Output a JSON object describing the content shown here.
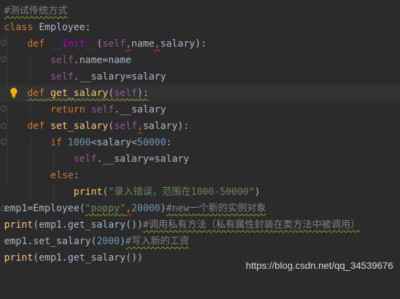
{
  "colors": {
    "background": "#2b2b2b",
    "keyword": "#cc7832",
    "function": "#ffc66d",
    "magic": "#b200b2",
    "self": "#94558d",
    "number": "#6897bb",
    "string": "#6a8759",
    "comment": "#808080",
    "text": "#a9b7c6"
  },
  "icons": {
    "fold": "fold-marker-icon",
    "hint": "lightbulb-icon"
  },
  "code": {
    "l1": {
      "comment": "#测试传统方式"
    },
    "l2": {
      "kw": "class",
      "name": " Employee",
      "colon": ":"
    },
    "l3": {
      "indent": "    ",
      "kw": "def",
      "sp": " ",
      "fn": "__init__",
      "open": "(",
      "self": "self",
      "c1": ",",
      "p1": "name",
      "c2": ",",
      "p2": "salary",
      "close": "):"
    },
    "l4": {
      "indent": "        ",
      "self": "self",
      "rest": ".name=name"
    },
    "l5": {
      "indent": "        ",
      "self": "self",
      "rest": ".__salary=salary"
    },
    "l6": {
      "indent": "    ",
      "kw": "def",
      "sp": " ",
      "fn": "get_salary",
      "open": "(",
      "self": "self",
      "close": "):"
    },
    "l7": {
      "indent": "        ",
      "kw": "return",
      "sp": " ",
      "self": "self",
      "rest": ".__salary"
    },
    "l8": {
      "indent": "    ",
      "kw": "def",
      "sp": " ",
      "fn": "set_salary",
      "open": "(",
      "self": "self",
      "c1": ",",
      "p1": "salary",
      "close": "):"
    },
    "l9": {
      "indent": "        ",
      "kw": "if",
      "sp": " ",
      "n1": "1000",
      "mid": "<salary<",
      "n2": "50000",
      "colon": ":"
    },
    "l10": {
      "indent": "            ",
      "self": "self",
      "rest": ".__salary=salary"
    },
    "l11": {
      "indent": "        ",
      "kw": "else",
      "colon": ":"
    },
    "l12": {
      "indent": "            ",
      "fn": "print",
      "open": "(",
      "str": "\"录入错误，范围在1000-50000\"",
      "close": ")"
    },
    "l13": {
      "a": "emp1=Employee(",
      "str": "\"poppy\"",
      "c1": ",",
      "num": "20000",
      "b": ")",
      "comment": "#new一个新的实例对象"
    },
    "l14": {
      "fn": "print",
      "a": "(emp1.get_salary())",
      "comment": "#调用私有方法（私有属性封装在类方法中被调用）"
    },
    "l15": {
      "a": "emp1.set_salary(",
      "num": "2000",
      "b": ")",
      "comment": "#写入新的工资"
    },
    "l16": {
      "fn": "print",
      "a": "(emp1.get_salary())"
    }
  },
  "watermark": "https://blog.csdn.net/qq_34539676"
}
